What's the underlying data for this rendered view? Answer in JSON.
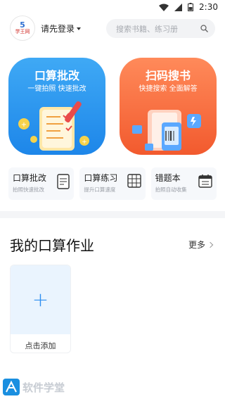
{
  "status": {
    "time": "2:30"
  },
  "header": {
    "logo_number": "5",
    "logo_text": "学王网",
    "login_label": "请先登录",
    "search_placeholder": "搜索书籍、练习册"
  },
  "cards": [
    {
      "title": "口算批改",
      "subtitle": "一键拍照 快速批改"
    },
    {
      "title": "扫码搜书",
      "subtitle": "快捷搜索 全面解答"
    }
  ],
  "tools": [
    {
      "title": "口算批改",
      "subtitle": "拍照快速批改"
    },
    {
      "title": "口算练习",
      "subtitle": "提升口算速度"
    },
    {
      "title": "错题本",
      "subtitle": "拍照自动收集"
    }
  ],
  "section": {
    "title": "我的口算作业",
    "more_label": "更多"
  },
  "add_card": {
    "label": "点击添加"
  },
  "watermark": {
    "text": "软件学堂"
  },
  "colors": {
    "blue": "#1d86e9",
    "orange": "#f25a2e",
    "accent": "#2e8ef0"
  }
}
